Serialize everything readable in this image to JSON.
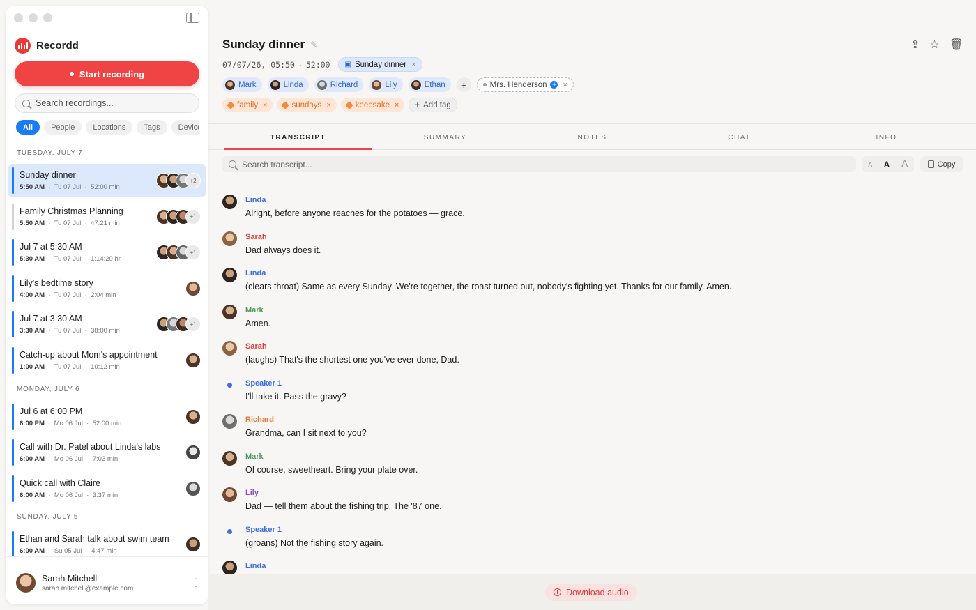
{
  "app": {
    "name": "Recordd"
  },
  "sidebar": {
    "start_recording": "Start recording",
    "search_placeholder": "Search recordings...",
    "filters": [
      "All",
      "People",
      "Locations",
      "Tags",
      "Devices"
    ],
    "days": [
      {
        "label": "TUESDAY, JULY 7",
        "items": [
          {
            "title": "Sunday dinner",
            "time": "5:50 AM",
            "date": "Tu 07 Jul",
            "duration": "52:00 min",
            "more": "+2"
          },
          {
            "title": "Family Christmas Planning",
            "time": "5:50 AM",
            "date": "Tu 07 Jul",
            "duration": "47:21 min",
            "more": "+1"
          },
          {
            "title": "Jul 7 at 5:30 AM",
            "time": "5:30 AM",
            "date": "Tu 07 Jul",
            "duration": "1:14:20 hr",
            "more": "+1"
          },
          {
            "title": "Lily's bedtime story",
            "time": "4:00 AM",
            "date": "Tu 07 Jul",
            "duration": "2:04 min",
            "more": ""
          },
          {
            "title": "Jul 7 at 3:30 AM",
            "time": "3:30 AM",
            "date": "Tu 07 Jul",
            "duration": "38:00 min",
            "more": "+1"
          },
          {
            "title": "Catch-up about Mom's appointment",
            "time": "1:00 AM",
            "date": "Tu 07 Jul",
            "duration": "10:12 min",
            "more": ""
          }
        ]
      },
      {
        "label": "MONDAY, JULY 6",
        "items": [
          {
            "title": "Jul 6 at 6:00 PM",
            "time": "6:00 PM",
            "date": "Mo 06 Jul",
            "duration": "52:00 min",
            "more": ""
          },
          {
            "title": "Call with Dr. Patel about Linda's labs",
            "time": "6:00 AM",
            "date": "Mo 06 Jul",
            "duration": "7:03 min",
            "more": ""
          },
          {
            "title": "Quick call with Claire",
            "time": "6:00 AM",
            "date": "Mo 06 Jul",
            "duration": "3:37 min",
            "more": ""
          }
        ]
      },
      {
        "label": "SUNDAY, JULY 5",
        "items": [
          {
            "title": "Ethan and Sarah talk about swim team",
            "time": "6:00 AM",
            "date": "Su 05 Jul",
            "duration": "4:47 min",
            "more": ""
          }
        ]
      }
    ],
    "account": {
      "name": "Sarah Mitchell",
      "email": "sarah.mitchell@example.com"
    }
  },
  "recording": {
    "title": "Sunday dinner",
    "datetime": "07/07/26, 05:50",
    "duration": "52:00",
    "event": "Sunday dinner",
    "people": [
      "Mark",
      "Linda",
      "Richard",
      "Lily",
      "Ethan"
    ],
    "guest": "Mrs. Henderson",
    "tags": [
      "family",
      "sundays",
      "keepsake"
    ],
    "add_tag": "Add tag"
  },
  "tabs": [
    "TRANSCRIPT",
    "SUMMARY",
    "NOTES",
    "CHAT",
    "INFO"
  ],
  "transcript_search_placeholder": "Search transcript...",
  "font_sizes": [
    "A",
    "A",
    "A"
  ],
  "copy_label": "Copy",
  "transcript": [
    {
      "speaker": "Linda",
      "text": "Alright, before anyone reaches for the potatoes — grace."
    },
    {
      "speaker": "Sarah",
      "text": "Dad always does it."
    },
    {
      "speaker": "Linda",
      "text": "(clears throat) Same as every Sunday. We're together, the roast turned out, nobody's fighting yet. Thanks for our family. Amen."
    },
    {
      "speaker": "Mark",
      "text": "Amen."
    },
    {
      "speaker": "Sarah",
      "text": "(laughs) That's the shortest one you've ever done, Dad."
    },
    {
      "speaker": "Speaker 1",
      "text": "I'll take it. Pass the gravy?"
    },
    {
      "speaker": "Richard",
      "text": "Grandma, can I sit next to you?"
    },
    {
      "speaker": "Mark",
      "text": "Of course, sweetheart. Bring your plate over."
    },
    {
      "speaker": "Lily",
      "text": "Dad — tell them about the fishing trip. The '87 one."
    },
    {
      "speaker": "Speaker 1",
      "text": "(groans) Not the fishing story again."
    },
    {
      "speaker": "Linda",
      "text": ""
    }
  ],
  "download_label": "Download audio",
  "colors": {
    "accent_red": "#ef4443",
    "accent_blue": "#1a7cf5",
    "speaker_linda": "#3d6fe0",
    "speaker_sarah": "#e53935",
    "speaker_mark": "#4f9a62",
    "speaker_richard": "#e8772e",
    "speaker_lily": "#8a4fd0",
    "speaker_1": "#3d6fe0"
  }
}
